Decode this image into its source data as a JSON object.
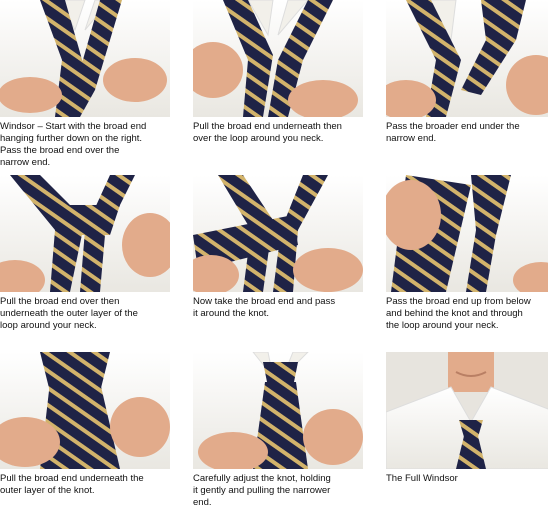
{
  "steps": [
    {
      "caption": "Windsor – Start with the broad end\nhanging further down on the right.\nPass the broad end over the\nnarrow end."
    },
    {
      "caption": "Pull the broad end underneath then\nover the loop around you neck."
    },
    {
      "caption": "Pass the broader end under the\nnarrow end."
    },
    {
      "caption": "Pull the broad end over then\nunderneath the outer layer of the\nloop around your neck."
    },
    {
      "caption": "Now take the broad end and pass\nit around the knot."
    },
    {
      "caption": "Pass the broad end up from below\nand behind the knot and through\nthe loop around your neck."
    },
    {
      "caption": "Pull the broad end underneath the\nouter layer of the knot."
    },
    {
      "caption": "Carefully adjust the knot, holding\nit gently and pulling the narrower\nend."
    },
    {
      "caption": "The Full Windsor"
    }
  ],
  "colors": {
    "shirt": "#f7f6f2",
    "tie_navy": "#1f2346",
    "tie_stripe": "#d2b36b",
    "skin": "#e2ab8b",
    "background": "#ece8e1"
  }
}
